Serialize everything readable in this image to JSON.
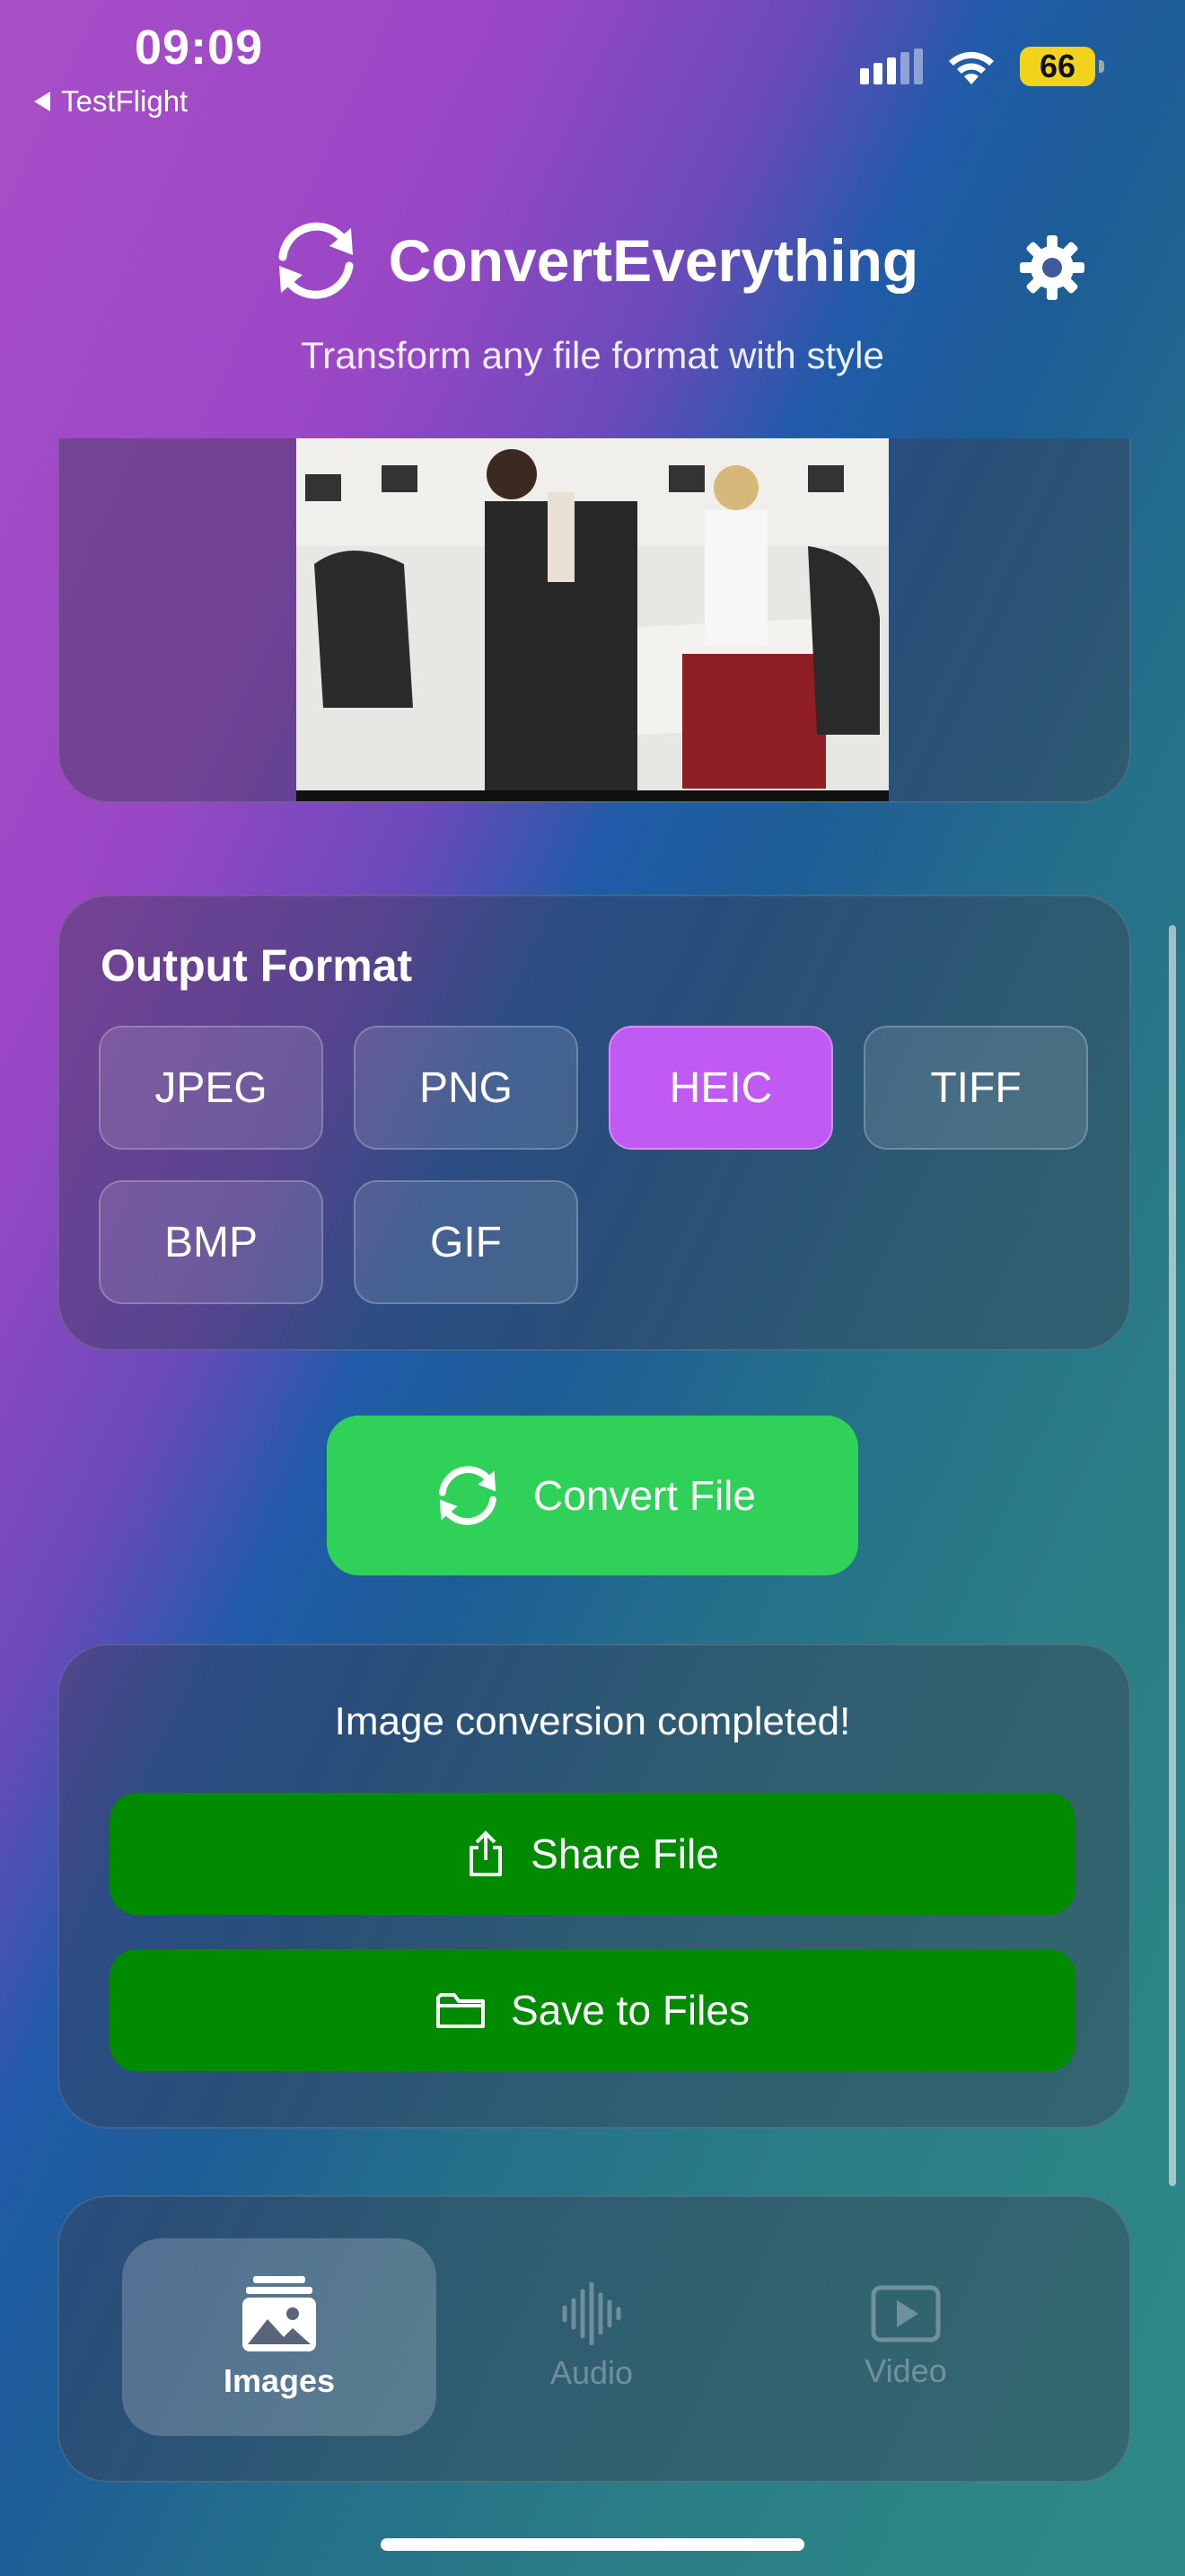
{
  "status": {
    "time": "09:09",
    "back_app": "TestFlight",
    "battery": "66"
  },
  "header": {
    "title": "ConvertEverything",
    "subtitle": "Transform any file format with style",
    "icons": [
      "refresh-icon",
      "gear-icon"
    ]
  },
  "output": {
    "title": "Output Format",
    "formats": [
      "JPEG",
      "PNG",
      "HEIC",
      "TIFF",
      "BMP",
      "GIF"
    ],
    "selected": "HEIC"
  },
  "convert": {
    "label": "Convert File",
    "color": "#30d158"
  },
  "result": {
    "message": "Image conversion completed!",
    "share_label": "Share File",
    "save_label": "Save to Files",
    "button_color": "#008a00"
  },
  "tabs": [
    {
      "label": "Images",
      "icon": "images-icon",
      "active": true
    },
    {
      "label": "Audio",
      "icon": "waveform-icon",
      "active": false
    },
    {
      "label": "Video",
      "icon": "play-rectangle-icon",
      "active": false
    }
  ],
  "colors": {
    "accent_selected": "#bf5af2"
  }
}
